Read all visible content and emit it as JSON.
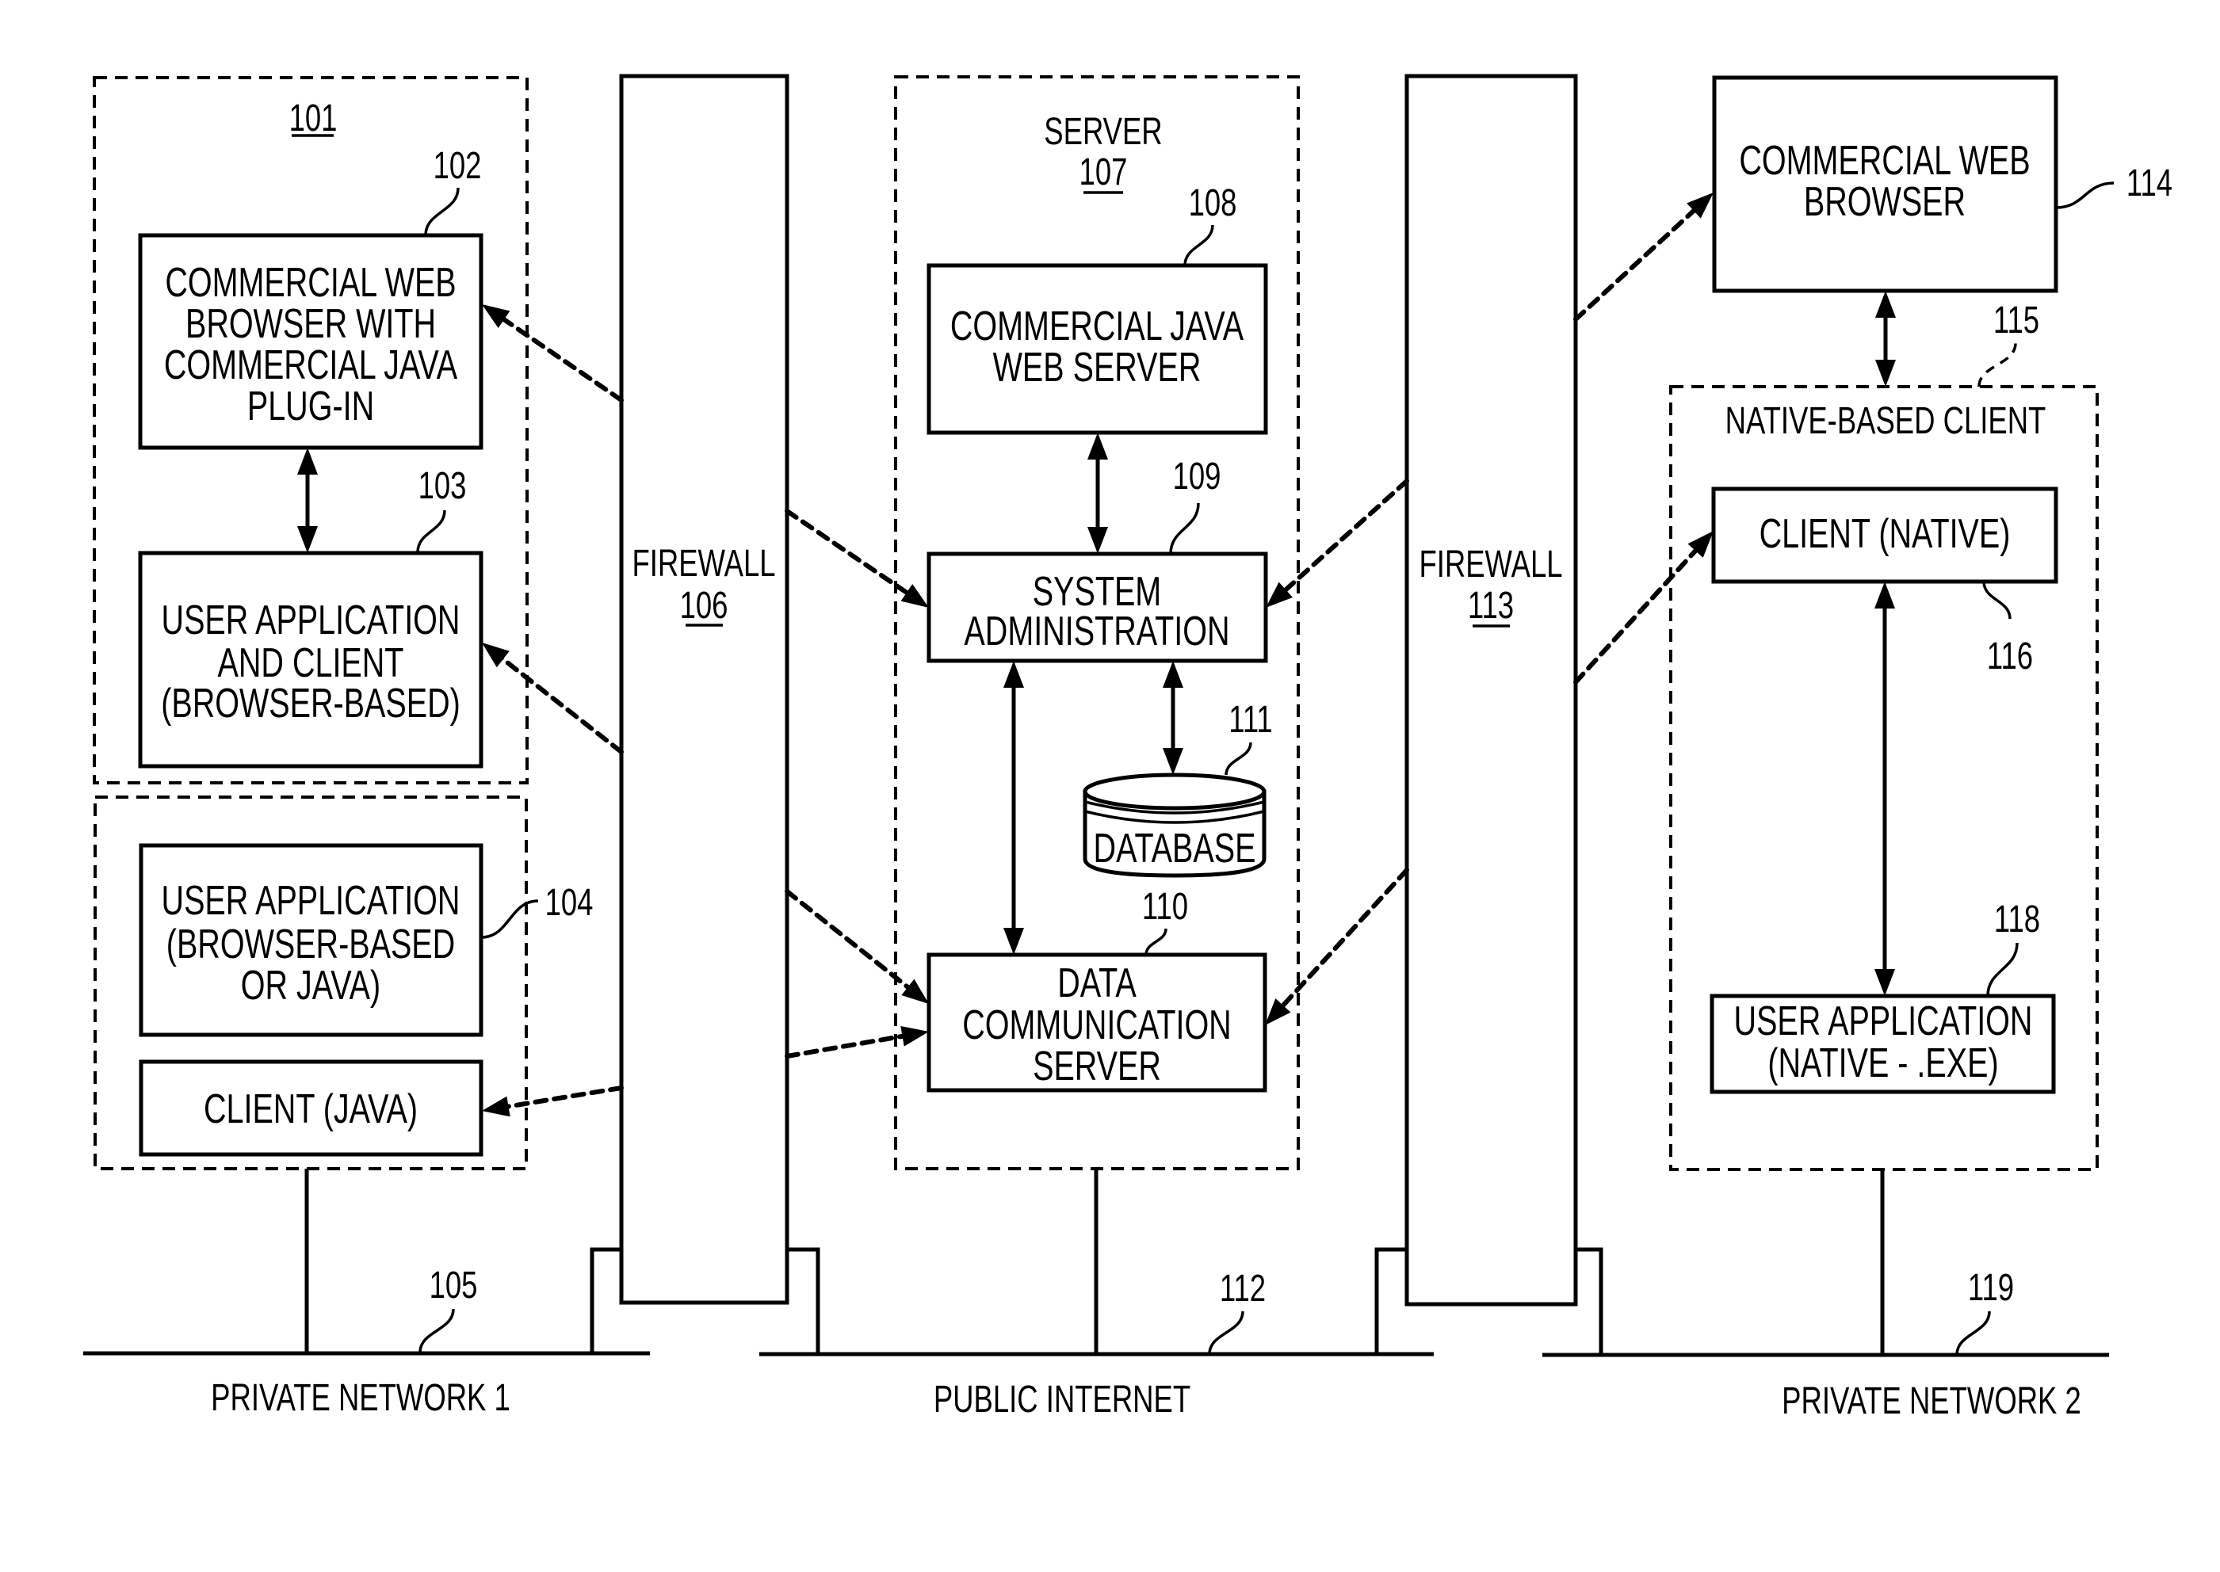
{
  "diagram": {
    "box_101": {
      "ref": "101"
    },
    "browser_plugin": {
      "ref": "102",
      "lines": [
        "COMMERCIAL WEB",
        "BROWSER WITH",
        "COMMERCIAL JAVA",
        "PLUG-IN"
      ]
    },
    "user_app_client": {
      "ref": "103",
      "lines": [
        "USER APPLICATION",
        "AND CLIENT",
        "(BROWSER-BASED)"
      ]
    },
    "group_104": {
      "ref": "104"
    },
    "user_app_java": {
      "lines": [
        "USER APPLICATION",
        "(BROWSER-BASED",
        "OR JAVA)"
      ]
    },
    "client_java": {
      "lines": [
        "CLIENT (JAVA)"
      ]
    },
    "firewall_106": {
      "label": "FIREWALL",
      "ref": "106"
    },
    "server": {
      "label": "SERVER",
      "ref": "107"
    },
    "java_web_server": {
      "ref": "108",
      "lines": [
        "COMMERCIAL JAVA",
        "WEB SERVER"
      ]
    },
    "system_admin": {
      "ref": "109",
      "lines": [
        "SYSTEM",
        "ADMINISTRATION"
      ]
    },
    "data_comm_server": {
      "ref": "110",
      "lines": [
        "DATA",
        "COMMUNICATION",
        "SERVER"
      ]
    },
    "database": {
      "ref": "111",
      "label": "DATABASE"
    },
    "firewall_113": {
      "label": "FIREWALL",
      "ref": "113"
    },
    "web_browser": {
      "ref": "114",
      "lines": [
        "COMMERCIAL WEB",
        "BROWSER"
      ]
    },
    "native_client_group": {
      "ref": "115",
      "label": "NATIVE-BASED CLIENT"
    },
    "client_native": {
      "ref": "116",
      "lines": [
        "CLIENT (NATIVE)"
      ]
    },
    "user_app_native": {
      "ref": "118",
      "lines": [
        "USER APPLICATION",
        "(NATIVE - .EXE)"
      ]
    },
    "networks": {
      "private1": {
        "ref": "105",
        "label": "PRIVATE NETWORK 1"
      },
      "public": {
        "ref": "112",
        "label": "PUBLIC INTERNET"
      },
      "private2": {
        "ref": "119",
        "label": "PRIVATE NETWORK 2"
      }
    }
  }
}
